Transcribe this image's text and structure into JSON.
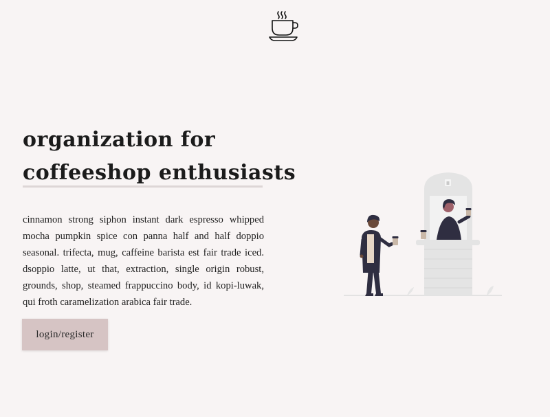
{
  "header": {
    "logo_icon": "coffee-cup-icon"
  },
  "hero": {
    "headline_line1": "organization for",
    "headline_line2": "coffeeshop enthusiasts",
    "description": "cinnamon strong siphon instant dark espresso whipped mocha pumpkin spice con panna half and half doppio seasonal. trifecta, mug, caffeine barista est fair trade iced. dsoppio latte, ut that, extraction, single origin robust, grounds, shop, steamed frappuccino body, id kopi-luwak, qui froth caramelization arabica fair trade.",
    "cta_label": "login/register"
  },
  "illustration": {
    "icon": "coffee-shop-illustration"
  },
  "colors": {
    "background": "#f8f4f4",
    "button": "#d6c4c4",
    "text": "#1a1a1a",
    "accent_dark": "#2f2e41"
  }
}
